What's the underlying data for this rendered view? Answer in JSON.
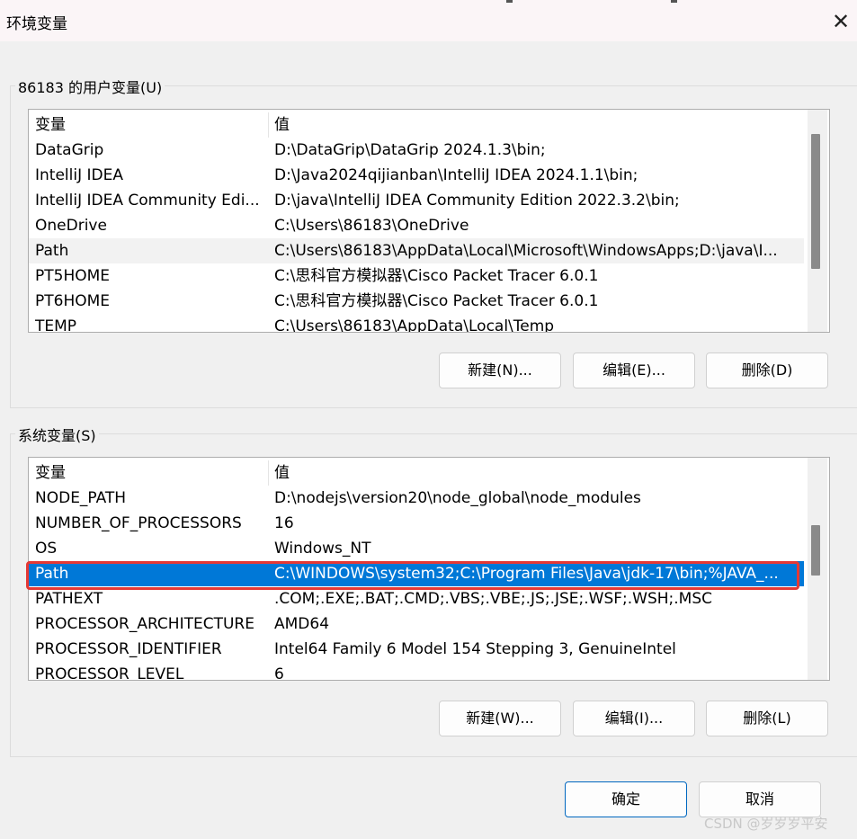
{
  "window": {
    "title": "环境变量",
    "close_glyph": "✕"
  },
  "user_group": {
    "label": "86183 的用户变量(U)",
    "columns": [
      "变量",
      "值"
    ],
    "rows": [
      [
        "DataGrip",
        "D:\\DataGrip\\DataGrip 2024.1.3\\bin;"
      ],
      [
        "IntelliJ IDEA",
        "D:\\Java2024qijianban\\IntelliJ IDEA 2024.1.1\\bin;"
      ],
      [
        "IntelliJ IDEA Community Edi...",
        "D:\\java\\IntelliJ IDEA Community Edition 2022.3.2\\bin;"
      ],
      [
        "OneDrive",
        "C:\\Users\\86183\\OneDrive"
      ],
      [
        "Path",
        "C:\\Users\\86183\\AppData\\Local\\Microsoft\\WindowsApps;D:\\java\\I..."
      ],
      [
        "PT5HOME",
        "C:\\思科官方模拟器\\Cisco Packet Tracer 6.0.1"
      ],
      [
        "PT6HOME",
        "C:\\思科官方模拟器\\Cisco Packet Tracer 6.0.1"
      ],
      [
        "TEMP",
        "C:\\Users\\86183\\AppData\\Local\\Temp"
      ]
    ],
    "buttons": {
      "new": "新建(N)...",
      "edit": "编辑(E)...",
      "delete": "删除(D)"
    }
  },
  "system_group": {
    "label": "系统变量(S)",
    "columns": [
      "变量",
      "值"
    ],
    "rows": [
      [
        "NODE_PATH",
        "D:\\nodejs\\version20\\node_global\\node_modules"
      ],
      [
        "NUMBER_OF_PROCESSORS",
        "16"
      ],
      [
        "OS",
        "Windows_NT"
      ],
      [
        "Path",
        "C:\\WINDOWS\\system32;C:\\Program Files\\Java\\jdk-17\\bin;%JAVA_..."
      ],
      [
        "PATHEXT",
        ".COM;.EXE;.BAT;.CMD;.VBS;.VBE;.JS;.JSE;.WSF;.WSH;.MSC"
      ],
      [
        "PROCESSOR_ARCHITECTURE",
        "AMD64"
      ],
      [
        "PROCESSOR_IDENTIFIER",
        "Intel64 Family 6 Model 154 Stepping 3, GenuineIntel"
      ],
      [
        "PROCESSOR_LEVEL",
        "6"
      ]
    ],
    "buttons": {
      "new": "新建(W)...",
      "edit": "编辑(I)...",
      "delete": "删除(L)"
    }
  },
  "footer": {
    "ok": "确定",
    "cancel": "取消"
  },
  "watermark": "CSDN @岁岁岁平安",
  "colors": {
    "selection": "#0078d7",
    "highlight_box": "#e53935",
    "ok_border": "#0067c0"
  }
}
